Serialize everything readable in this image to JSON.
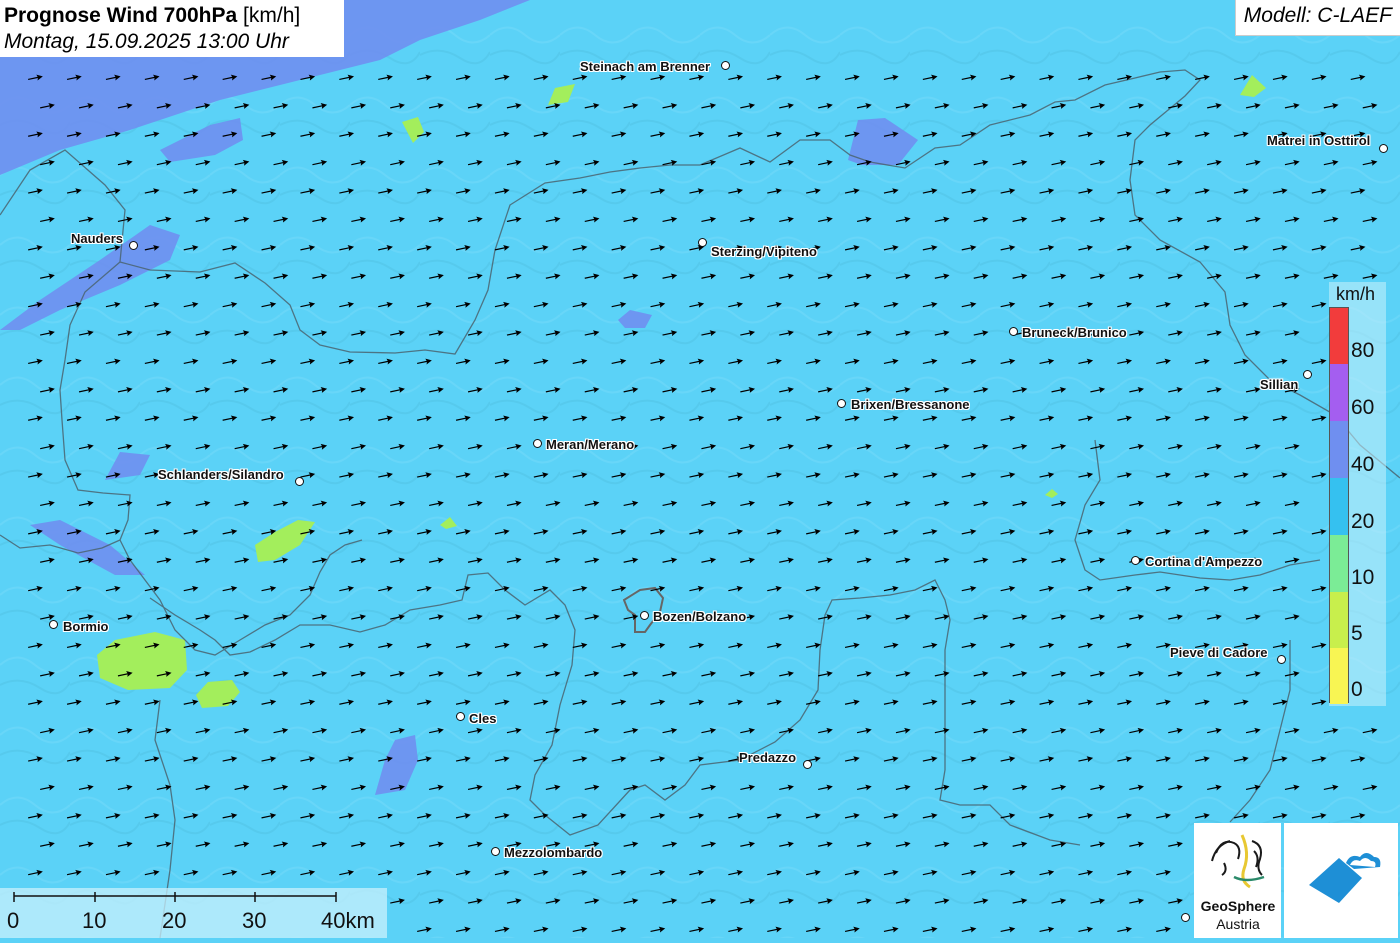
{
  "title": {
    "bold": "Prognose Wind 700hPa",
    "unit": "[km/h]",
    "datetime": "Montag, 15.09.2025 13:00 Uhr"
  },
  "model": "Modell: C-LAEF",
  "colors": {
    "background": "#5bd2f7",
    "band_20_40": "#5bd2f7",
    "band_40_60": "#6f8ff0",
    "band_5_10": "#a3ee5c",
    "band_10_20": "#7bec96",
    "band_60_80": "#a45ef0",
    "band_80": "#f23c3c",
    "band_0_5": "#f8f553",
    "arrow": "#000000",
    "border": "#4a6470"
  },
  "legend": {
    "unit": "km/h",
    "ticks": [
      "80",
      "60",
      "40",
      "20",
      "10",
      "5",
      "0"
    ]
  },
  "cities": [
    {
      "name": "Steinach am Brenner"
    },
    {
      "name": "Matrei in Osttirol"
    },
    {
      "name": "Nauders"
    },
    {
      "name": "Sterzing/Vipiteno"
    },
    {
      "name": "Bruneck/Brunico"
    },
    {
      "name": "Sillian"
    },
    {
      "name": "Brixen/Bressanone"
    },
    {
      "name": "Meran/Merano"
    },
    {
      "name": "Schlanders/Silandro"
    },
    {
      "name": "Cortina d'Ampezzo"
    },
    {
      "name": "Bormio"
    },
    {
      "name": "Bozen/Bolzano"
    },
    {
      "name": "Pieve di Cadore"
    },
    {
      "name": "Cles"
    },
    {
      "name": "Predazzo"
    },
    {
      "name": "Mezzolombardo"
    }
  ],
  "scale": {
    "labels": [
      "0",
      "10",
      "20",
      "30",
      "40km"
    ]
  },
  "wind": {
    "direction": "west-southwest",
    "typical_speed_kmh": "20-40"
  },
  "logos": {
    "geosphere_line1": "GeoSphere",
    "geosphere_line2": "Austria"
  }
}
